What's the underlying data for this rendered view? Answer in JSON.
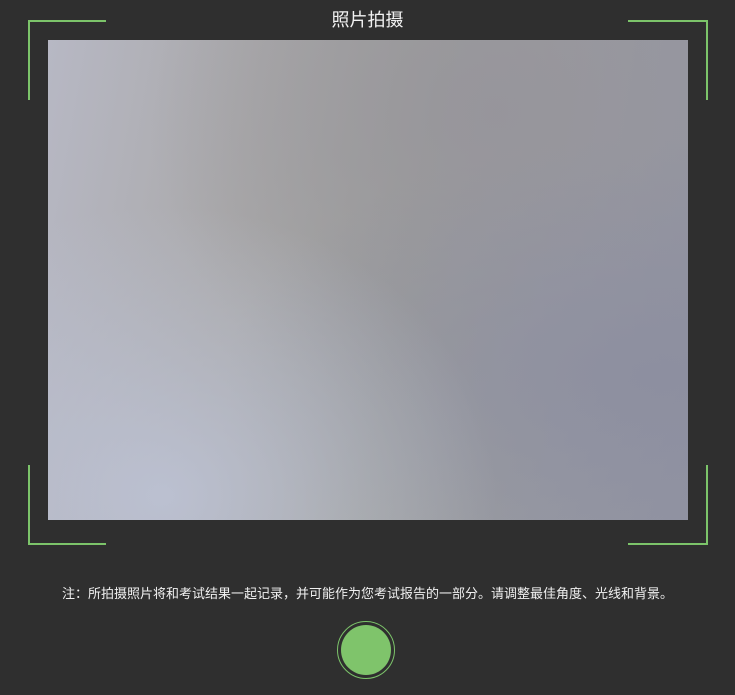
{
  "title": "照片拍摄",
  "note": "注：所拍摄照片将和考试结果一起记录，并可能作为您考试报告的一部分。请调整最佳角度、光线和背景。",
  "colors": {
    "background": "#2f2f2f",
    "accent": "#7cc46a",
    "text": "#f2f2f2"
  },
  "icons": {
    "corners": "viewfinder-corner-icon",
    "shutter": "shutter-button"
  }
}
